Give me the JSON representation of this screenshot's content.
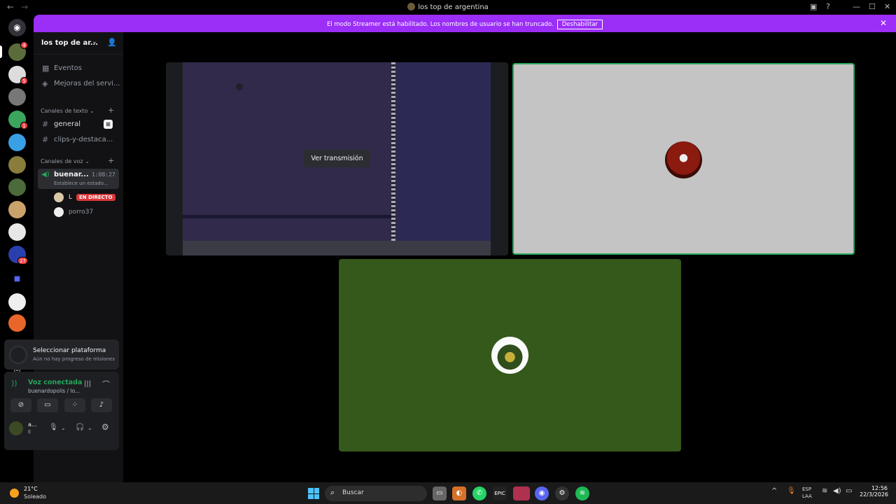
{
  "window": {
    "title": "los top de argentina"
  },
  "banner": {
    "message": "El modo Streamer está habilitado. Los nombres de usuario se han truncado.",
    "button": "Deshabilitar"
  },
  "guilds": {
    "badges": [
      "4",
      "5",
      "1",
      "27"
    ]
  },
  "sidebar": {
    "server_name": "los top de ar...",
    "items": [
      {
        "label": "Eventos"
      },
      {
        "label": "Mejoras del servi..."
      }
    ],
    "text_category": "Canales de texto",
    "text_channels": [
      {
        "label": "general"
      },
      {
        "label": "clips-y-destaca..."
      }
    ],
    "voice_category": "Canales de voz",
    "voice_channel": {
      "name": "buenar...",
      "timer": "1:08:27",
      "status": "Establece un estado..."
    },
    "users": [
      {
        "name": "L",
        "live": "EN DIRECTO"
      },
      {
        "name": "porro37"
      }
    ]
  },
  "quest": {
    "title": "Seleccionar plataforma",
    "subtitle": "Aún no hay progreso de misiones"
  },
  "voice_panel": {
    "status": "Voz conectada",
    "channel": "buenardopolis / lo..."
  },
  "user_bar": {
    "name": "a...",
    "status": "E"
  },
  "stage": {
    "watch_button": "Ver transmisión"
  },
  "taskbar": {
    "temp": "21°C",
    "condition": "Soleado",
    "search_placeholder": "Buscar",
    "lang1": "ESP",
    "lang2": "LAA",
    "time": "12:56",
    "date": "22/3/2026"
  },
  "colors": {
    "streamer_banner": "#9b2ef7",
    "speaking_border": "#23a55a",
    "live_badge": "#da373c",
    "tile_green": "#35581b",
    "tile_gray": "#c4c4c4"
  }
}
